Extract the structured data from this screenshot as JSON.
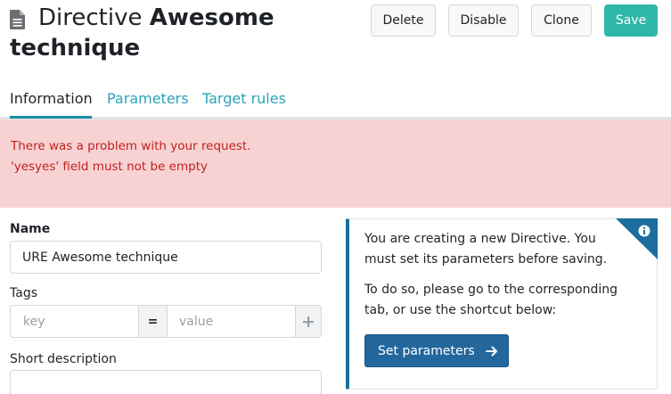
{
  "header": {
    "title_prefix": "Directive",
    "title_name": "Awesome technique",
    "buttons": {
      "delete": "Delete",
      "disable": "Disable",
      "clone": "Clone",
      "save": "Save"
    }
  },
  "tabs": [
    {
      "label": "Information",
      "active": true
    },
    {
      "label": "Parameters",
      "active": false
    },
    {
      "label": "Target rules",
      "active": false
    }
  ],
  "alert": {
    "line1": "There was a problem with your request.",
    "line2": "'yesyes' field must not be empty"
  },
  "form": {
    "name_label": "Name",
    "name_value": "URE Awesome technique",
    "tags_label": "Tags",
    "tag_key_placeholder": "key",
    "tag_separator": "=",
    "tag_value_placeholder": "value",
    "short_description_label": "Short description",
    "short_description_value": ""
  },
  "info_panel": {
    "paragraph1": "You are creating a new Directive. You must set its parameters before saving.",
    "paragraph2": "To do so, please go to the corresponding tab, or use the shortcut below:",
    "button_label": "Set parameters"
  },
  "icons": {
    "title": "file-text-icon",
    "tag_add": "plus-icon",
    "info_corner": "info-icon",
    "set_params": "arrow-right-icon"
  },
  "colors": {
    "accent_teal": "#2fb7a9",
    "tab_link": "#2aa3b8",
    "alert_bg": "#f8d2d2",
    "alert_text": "#c21f1f",
    "primary_blue": "#23679c",
    "info_border": "#1b6e9e"
  }
}
